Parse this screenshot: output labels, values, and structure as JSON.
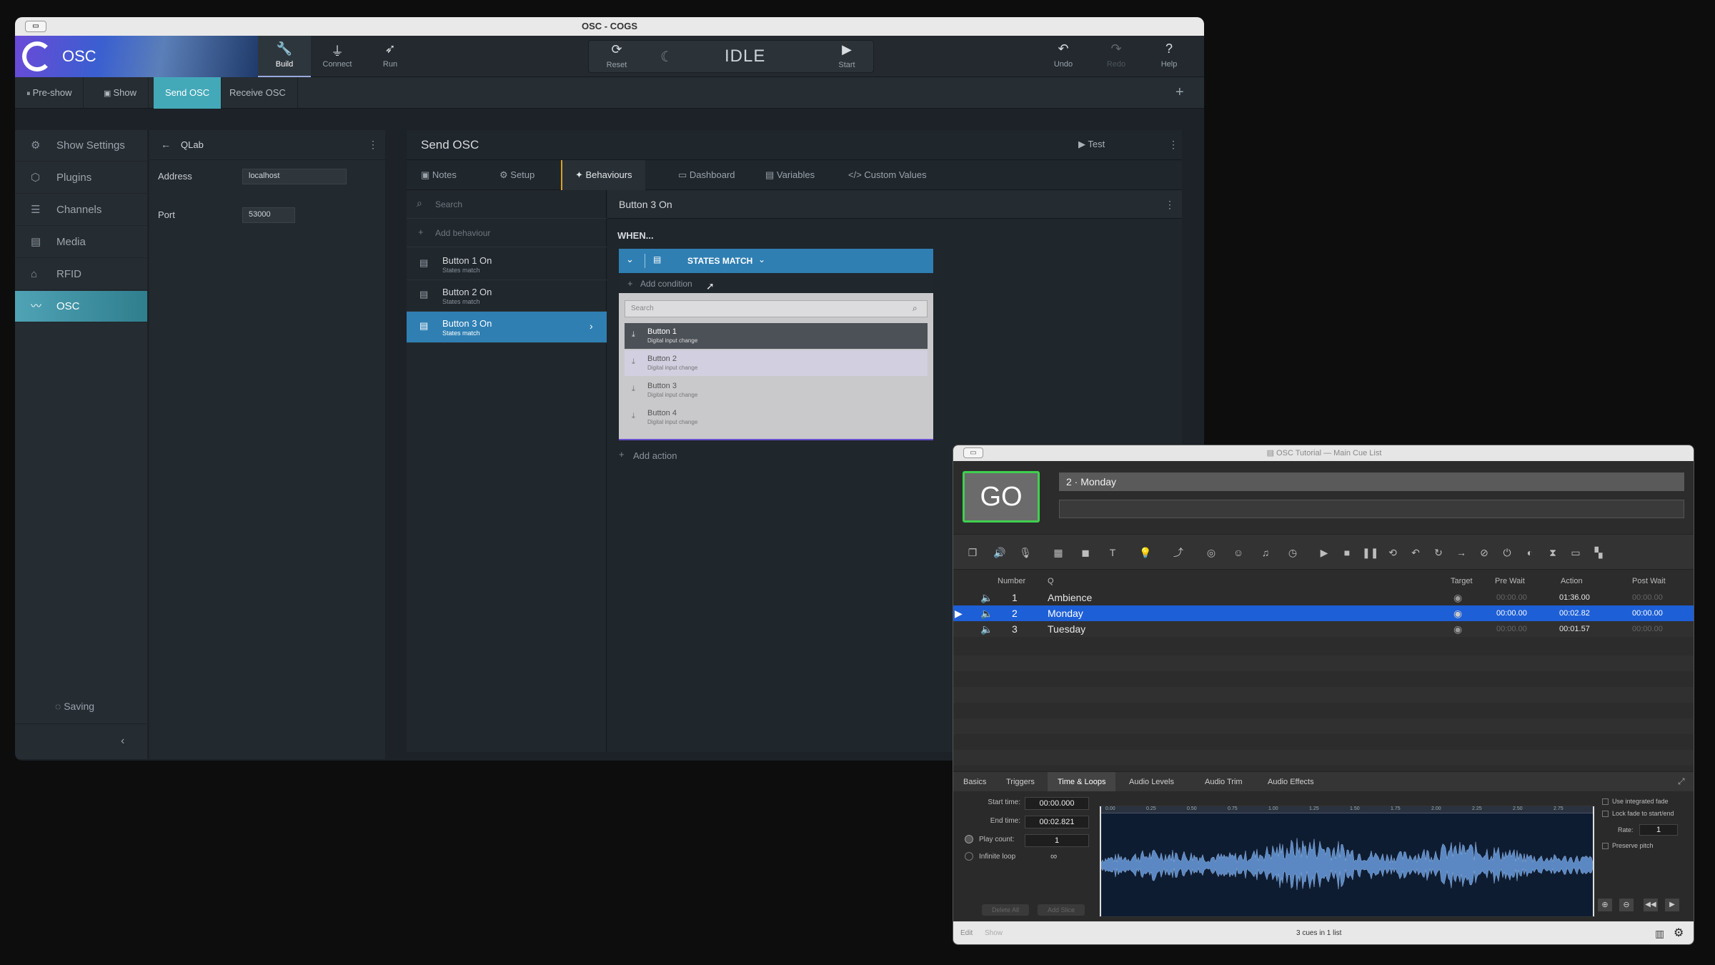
{
  "cogs": {
    "window_title": "OSC - COGS",
    "brand": "OSC",
    "toolbar": [
      {
        "label": "Build",
        "icon": "wrench-icon",
        "glyph": "🔧"
      },
      {
        "label": "Connect",
        "icon": "plug-icon",
        "glyph": "⏚"
      },
      {
        "label": "Run",
        "icon": "rocket-icon",
        "glyph": "➶"
      }
    ],
    "run_control": {
      "reset_label": "Reset",
      "status": "IDLE",
      "start_label": "Start"
    },
    "right_tools": [
      {
        "label": "Undo",
        "icon": "undo-icon",
        "glyph": "↶"
      },
      {
        "label": "Redo",
        "icon": "redo-icon",
        "glyph": "↷"
      },
      {
        "label": "Help",
        "icon": "help-icon",
        "glyph": "?"
      }
    ],
    "show_tabs": [
      "Pre-show",
      "Show",
      "Send OSC",
      "Receive OSC"
    ],
    "active_show_tab": "Send OSC",
    "sidebar": {
      "items": [
        {
          "label": "Show Settings",
          "icon": "gear-icon",
          "glyph": "⚙"
        },
        {
          "label": "Plugins",
          "icon": "plugin-icon",
          "glyph": "⬡"
        },
        {
          "label": "Channels",
          "icon": "channels-icon",
          "glyph": "☰"
        },
        {
          "label": "Media",
          "icon": "media-icon",
          "glyph": "▤"
        },
        {
          "label": "RFID",
          "icon": "tag-icon",
          "glyph": "⌂"
        },
        {
          "label": "OSC",
          "icon": "waveform-icon",
          "glyph": "〰"
        }
      ],
      "saving": "Saving"
    },
    "plugin_panel": {
      "title": "QLab",
      "address_label": "Address",
      "address_value": "localhost",
      "port_label": "Port",
      "port_value": "53000"
    },
    "send_panel": {
      "title": "Send OSC",
      "test_label": "Test",
      "tabs": [
        "Notes",
        "Setup",
        "Behaviours",
        "Dashboard",
        "Variables",
        "Custom Values"
      ],
      "active_tab": "Behaviours",
      "search_placeholder": "Search",
      "add_behaviour": "Add behaviour",
      "behaviours": [
        {
          "title": "Button 1 On",
          "subtitle": "States match"
        },
        {
          "title": "Button 2 On",
          "subtitle": "States match"
        },
        {
          "title": "Button 3 On",
          "subtitle": "States match"
        }
      ],
      "selected_behaviour_title": "Button 3 On",
      "when_label": "WHEN...",
      "condition_header": "STATES MATCH",
      "add_condition": "Add condition",
      "dropdown_search_placeholder": "Search",
      "dropdown_items": [
        {
          "title": "Button 1",
          "subtitle": "Digital input change"
        },
        {
          "title": "Button 2",
          "subtitle": "Digital input change"
        },
        {
          "title": "Button 3",
          "subtitle": "Digital input change"
        },
        {
          "title": "Button 4",
          "subtitle": "Digital input change"
        }
      ],
      "add_action": "Add action"
    }
  },
  "qlab": {
    "window_title": "OSC Tutorial — Main Cue List",
    "go_label": "GO",
    "current_cue": "2 · Monday",
    "columns": {
      "number": "Number",
      "q": "Q",
      "target": "Target",
      "pre_wait": "Pre Wait",
      "action": "Action",
      "post_wait": "Post Wait"
    },
    "cues": [
      {
        "number": "1",
        "name": "Ambience",
        "pre_wait": "00:00.00",
        "action": "01:36.00",
        "post_wait": "00:00.00"
      },
      {
        "number": "2",
        "name": "Monday",
        "pre_wait": "00:00.00",
        "action": "00:02.82",
        "post_wait": "00:00.00"
      },
      {
        "number": "3",
        "name": "Tuesday",
        "pre_wait": "00:00.00",
        "action": "00:01.57",
        "post_wait": "00:00.00"
      }
    ],
    "selected_cue": "2",
    "inspector_tabs": [
      "Basics",
      "Triggers",
      "Time & Loops",
      "Audio Levels",
      "Audio Trim",
      "Audio Effects"
    ],
    "active_inspector_tab": "Time & Loops",
    "time_loops": {
      "start_time_label": "Start time:",
      "start_time": "00:00.000",
      "end_time_label": "End time:",
      "end_time": "00:02.821",
      "play_count_label": "Play count:",
      "play_count": "1",
      "infinite_loop_label": "Infinite loop",
      "infinite_value": "∞",
      "delete_all": "Delete All",
      "add_slice": "Add Slice",
      "use_integrated_fade": "Use integrated fade",
      "lock_fade": "Lock fade to start/end",
      "rate_label": "Rate:",
      "rate": "1",
      "preserve_pitch": "Preserve pitch"
    },
    "ruler_ticks": [
      "0.00",
      "0.25",
      "0.50",
      "0.75",
      "1.00",
      "1.25",
      "1.50",
      "1.75",
      "2.00",
      "2.25",
      "2.50",
      "2.75"
    ],
    "status": {
      "edit": "Edit",
      "show": "Show",
      "summary": "3 cues in 1 list"
    }
  }
}
